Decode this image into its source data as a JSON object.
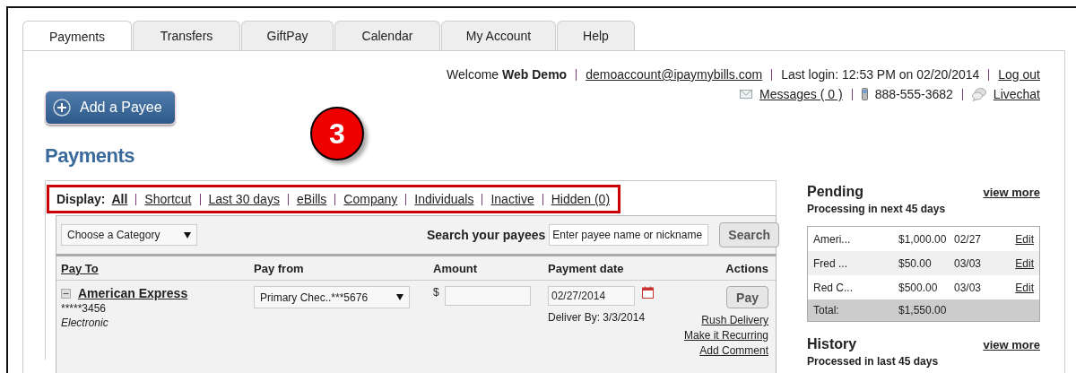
{
  "tabs": [
    {
      "label": "Payments",
      "selected": true
    },
    {
      "label": "Transfers",
      "selected": false
    },
    {
      "label": "GiftPay",
      "selected": false
    },
    {
      "label": "Calendar",
      "selected": false
    },
    {
      "label": "My Account",
      "selected": false
    },
    {
      "label": "Help",
      "selected": false
    }
  ],
  "account_bar": {
    "welcome": "Welcome",
    "user": "Web Demo",
    "email": "demoaccount@ipaymybills.com",
    "last_login": "Last login: 12:53 PM on 02/20/2014",
    "logout": "Log out",
    "messages": "Messages ( 0 )",
    "phone": "888-555-3682",
    "livechat": "Livechat"
  },
  "add_payee_button": "Add a Payee",
  "callout": "3",
  "heading": "Payments",
  "display_filter": {
    "label": "Display:",
    "highlighted": true,
    "options": [
      {
        "label": "All",
        "selected": true
      },
      {
        "label": "Shortcut",
        "selected": false
      },
      {
        "label": "Last 30 days",
        "selected": false
      },
      {
        "label": "eBills",
        "selected": false
      },
      {
        "label": "Company",
        "selected": false
      },
      {
        "label": "Individuals",
        "selected": false
      },
      {
        "label": "Inactive",
        "selected": false
      },
      {
        "label": "Hidden (0)",
        "selected": false
      }
    ]
  },
  "category_select": "Choose a Category",
  "search": {
    "label": "Search your payees",
    "placeholder": "Enter payee name or nickname",
    "button": "Search"
  },
  "columns": [
    {
      "label": "Pay To",
      "sortable": true
    },
    {
      "label": "Pay from",
      "sortable": false
    },
    {
      "label": "Amount",
      "sortable": false
    },
    {
      "label": "Payment date",
      "sortable": false
    },
    {
      "label": "Actions",
      "sortable": false
    }
  ],
  "payees": [
    {
      "name": "American Express",
      "expanded": true,
      "account": "*****3456",
      "method": "Electronic",
      "pay_from": "Primary Chec..***5676",
      "currency": "$",
      "date": "02/27/2014",
      "deliver_by": "Deliver By: 3/3/2014",
      "pay_button": "Pay",
      "actions": [
        "Rush Delivery",
        "Make it Recurring",
        "Add Comment"
      ]
    }
  ],
  "pending": {
    "title": "Pending",
    "view_more": "view more",
    "subtitle": "Processing in next 45 days",
    "rows": [
      {
        "payee": "Ameri...",
        "amount": "$1,000.00",
        "date": "02/27",
        "action": "Edit"
      },
      {
        "payee": "Fred ...",
        "amount": "$50.00",
        "date": "03/03",
        "action": "Edit"
      },
      {
        "payee": "Red C...",
        "amount": "$500.00",
        "date": "03/03",
        "action": "Edit"
      }
    ],
    "total": {
      "label": "Total:",
      "amount": "$1,550.00"
    }
  },
  "history": {
    "title": "History",
    "view_more": "view more",
    "subtitle": "Processed in last 45 days"
  }
}
